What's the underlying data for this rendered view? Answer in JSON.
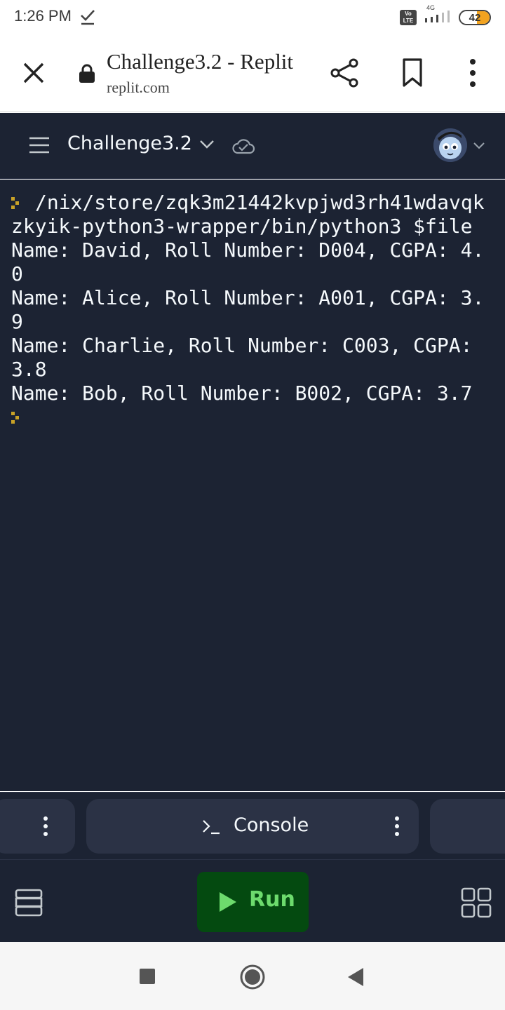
{
  "status_bar": {
    "time": "1:26 PM",
    "network_badge": "Vo LTE",
    "network_type": "4G",
    "battery": "42",
    "icons": [
      "check-notification-icon",
      "signal-icon",
      "battery-icon"
    ]
  },
  "browser": {
    "page_title": "Challenge3.2 - Replit",
    "domain": "replit.com",
    "icons": [
      "close-icon",
      "lock-icon",
      "share-icon",
      "bookmark-icon",
      "more-vert-icon"
    ]
  },
  "app_header": {
    "repl_name": "Challenge3.2",
    "icons": [
      "menu-icon",
      "chevron-down-icon",
      "cloud-check-icon",
      "avatar",
      "chevron-down-icon"
    ]
  },
  "console": {
    "lines": [
      {
        "prompt": true,
        "text": "/nix/store/zqk3m21442kvpjwd3rh41wdavqkzkyik-python3-wrapper/bin/python3 $file"
      },
      {
        "prompt": false,
        "text": "Name: David, Roll Number: D004, CGPA: 4.0"
      },
      {
        "prompt": false,
        "text": "Name: Alice, Roll Number: A001, CGPA: 3.9"
      },
      {
        "prompt": false,
        "text": "Name: Charlie, Roll Number: C003, CGPA: 3.8"
      },
      {
        "prompt": false,
        "text": "Name: Bob, Roll Number: B002, CGPA: 3.7"
      },
      {
        "prompt": true,
        "text": ""
      }
    ]
  },
  "tabs": {
    "console_label": "Console",
    "icons": [
      "terminal-icon",
      "more-vert-icon"
    ]
  },
  "toolbar": {
    "run_label": "Run",
    "icons": [
      "stack-icon",
      "play-icon",
      "grid-icon"
    ]
  },
  "colors": {
    "background": "#1c2333",
    "surface": "#2b3245",
    "run_button": "#044a10",
    "run_text": "#6ddb6d",
    "prompt": "#c9a227"
  }
}
